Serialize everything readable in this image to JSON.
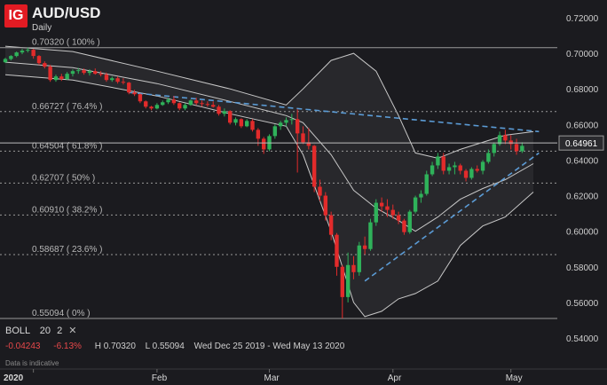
{
  "header": {
    "logo": "IG",
    "symbol": "AUD/USD",
    "timeframe": "Daily"
  },
  "indicator": {
    "name": "BOLL",
    "period": "20",
    "deviation": "2",
    "close_glyph": "✕"
  },
  "stats": {
    "change": "-0.04243",
    "change_pct": "-6.13%",
    "high": "H 0.70320",
    "low": "L 0.55094",
    "range": "Wed Dec 25 2019 - Wed May 13 2020"
  },
  "note": "Data is indicative",
  "colors": {
    "background": "#1b1b1f",
    "up_candle": "#2fb25a",
    "down_candle": "#e22b2b",
    "bands": "#c8c8c8",
    "trendline": "#5b9bd5",
    "logo": "#e21b23"
  },
  "chart_data": {
    "type": "candlestick",
    "instrument": "AUD/USD",
    "ylim": [
      0.54,
      0.72
    ],
    "y_ticks": [
      0.54,
      0.56,
      0.58,
      0.6,
      0.62,
      0.64,
      0.66,
      0.68,
      0.7,
      0.72
    ],
    "x_ticks": [
      "2020",
      "Feb",
      "Mar",
      "Apr",
      "May"
    ],
    "current_price": 0.64961,
    "fibonacci_levels": [
      {
        "label": "0.70320 ( 100% )",
        "value": 0.7032
      },
      {
        "label": "0.66727 ( 76.4% )",
        "value": 0.66727
      },
      {
        "label": "0.64504 ( 61.8% )",
        "value": 0.64504
      },
      {
        "label": "0.62707 ( 50% )",
        "value": 0.62707
      },
      {
        "label": "0.60910 ( 38.2% )",
        "value": 0.6091
      },
      {
        "label": "0.58687 ( 23.6% )",
        "value": 0.58687
      },
      {
        "label": "0.55094 ( 0% )",
        "value": 0.55094
      }
    ],
    "candles": [
      {
        "date": "2019-12-25",
        "o": 0.695,
        "h": 0.6975,
        "l": 0.6945,
        "c": 0.6968
      },
      {
        "date": "2019-12-26",
        "o": 0.6968,
        "h": 0.699,
        "l": 0.696,
        "c": 0.6985
      },
      {
        "date": "2019-12-27",
        "o": 0.6985,
        "h": 0.701,
        "l": 0.6978,
        "c": 0.7005
      },
      {
        "date": "2019-12-30",
        "o": 0.7005,
        "h": 0.7025,
        "l": 0.6995,
        "c": 0.7015
      },
      {
        "date": "2019-12-31",
        "o": 0.7015,
        "h": 0.7032,
        "l": 0.7005,
        "c": 0.702
      },
      {
        "date": "2020-01-02",
        "o": 0.702,
        "h": 0.7025,
        "l": 0.697,
        "c": 0.6985
      },
      {
        "date": "2020-01-03",
        "o": 0.6985,
        "h": 0.699,
        "l": 0.6935,
        "c": 0.6945
      },
      {
        "date": "2020-01-06",
        "o": 0.6945,
        "h": 0.6955,
        "l": 0.6915,
        "c": 0.6925
      },
      {
        "date": "2020-01-07",
        "o": 0.6925,
        "h": 0.6935,
        "l": 0.684,
        "c": 0.685
      },
      {
        "date": "2020-01-08",
        "o": 0.685,
        "h": 0.688,
        "l": 0.684,
        "c": 0.687
      },
      {
        "date": "2020-01-09",
        "o": 0.687,
        "h": 0.6885,
        "l": 0.6845,
        "c": 0.6855
      },
      {
        "date": "2020-01-10",
        "o": 0.6855,
        "h": 0.6895,
        "l": 0.685,
        "c": 0.6885
      },
      {
        "date": "2020-01-13",
        "o": 0.6885,
        "h": 0.691,
        "l": 0.687,
        "c": 0.69
      },
      {
        "date": "2020-01-14",
        "o": 0.69,
        "h": 0.6918,
        "l": 0.6885,
        "c": 0.6905
      },
      {
        "date": "2020-01-15",
        "o": 0.6905,
        "h": 0.6915,
        "l": 0.688,
        "c": 0.689
      },
      {
        "date": "2020-01-16",
        "o": 0.689,
        "h": 0.691,
        "l": 0.6875,
        "c": 0.69
      },
      {
        "date": "2020-01-17",
        "o": 0.69,
        "h": 0.6915,
        "l": 0.688,
        "c": 0.6885
      },
      {
        "date": "2020-01-20",
        "o": 0.6885,
        "h": 0.69,
        "l": 0.687,
        "c": 0.688
      },
      {
        "date": "2020-01-21",
        "o": 0.688,
        "h": 0.6892,
        "l": 0.684,
        "c": 0.685
      },
      {
        "date": "2020-01-22",
        "o": 0.685,
        "h": 0.687,
        "l": 0.684,
        "c": 0.686
      },
      {
        "date": "2020-01-23",
        "o": 0.686,
        "h": 0.687,
        "l": 0.683,
        "c": 0.684
      },
      {
        "date": "2020-01-24",
        "o": 0.684,
        "h": 0.686,
        "l": 0.6825,
        "c": 0.6835
      },
      {
        "date": "2020-01-27",
        "o": 0.6835,
        "h": 0.684,
        "l": 0.677,
        "c": 0.678
      },
      {
        "date": "2020-01-28",
        "o": 0.678,
        "h": 0.6795,
        "l": 0.676,
        "c": 0.677
      },
      {
        "date": "2020-01-29",
        "o": 0.677,
        "h": 0.6775,
        "l": 0.672,
        "c": 0.673
      },
      {
        "date": "2020-01-30",
        "o": 0.673,
        "h": 0.6735,
        "l": 0.669,
        "c": 0.67
      },
      {
        "date": "2020-01-31",
        "o": 0.67,
        "h": 0.6705,
        "l": 0.668,
        "c": 0.669
      },
      {
        "date": "2020-02-03",
        "o": 0.669,
        "h": 0.672,
        "l": 0.6685,
        "c": 0.671
      },
      {
        "date": "2020-02-04",
        "o": 0.671,
        "h": 0.6735,
        "l": 0.6705,
        "c": 0.6725
      },
      {
        "date": "2020-02-05",
        "o": 0.6725,
        "h": 0.675,
        "l": 0.6715,
        "c": 0.674
      },
      {
        "date": "2020-02-06",
        "o": 0.674,
        "h": 0.676,
        "l": 0.671,
        "c": 0.672
      },
      {
        "date": "2020-02-07",
        "o": 0.672,
        "h": 0.6725,
        "l": 0.668,
        "c": 0.669
      },
      {
        "date": "2020-02-10",
        "o": 0.669,
        "h": 0.672,
        "l": 0.668,
        "c": 0.671
      },
      {
        "date": "2020-02-11",
        "o": 0.671,
        "h": 0.674,
        "l": 0.6705,
        "c": 0.6735
      },
      {
        "date": "2020-02-12",
        "o": 0.6735,
        "h": 0.675,
        "l": 0.671,
        "c": 0.672
      },
      {
        "date": "2020-02-13",
        "o": 0.672,
        "h": 0.6735,
        "l": 0.67,
        "c": 0.6715
      },
      {
        "date": "2020-02-14",
        "o": 0.6715,
        "h": 0.673,
        "l": 0.67,
        "c": 0.671
      },
      {
        "date": "2020-02-17",
        "o": 0.671,
        "h": 0.673,
        "l": 0.6695,
        "c": 0.67
      },
      {
        "date": "2020-02-18",
        "o": 0.67,
        "h": 0.671,
        "l": 0.665,
        "c": 0.666
      },
      {
        "date": "2020-02-19",
        "o": 0.666,
        "h": 0.669,
        "l": 0.6645,
        "c": 0.6675
      },
      {
        "date": "2020-02-20",
        "o": 0.6675,
        "h": 0.668,
        "l": 0.66,
        "c": 0.661
      },
      {
        "date": "2020-02-21",
        "o": 0.661,
        "h": 0.664,
        "l": 0.6595,
        "c": 0.663
      },
      {
        "date": "2020-02-24",
        "o": 0.663,
        "h": 0.6635,
        "l": 0.658,
        "c": 0.659
      },
      {
        "date": "2020-02-25",
        "o": 0.659,
        "h": 0.663,
        "l": 0.6585,
        "c": 0.662
      },
      {
        "date": "2020-02-26",
        "o": 0.662,
        "h": 0.663,
        "l": 0.656,
        "c": 0.657
      },
      {
        "date": "2020-02-27",
        "o": 0.657,
        "h": 0.658,
        "l": 0.648,
        "c": 0.652
      },
      {
        "date": "2020-02-28",
        "o": 0.652,
        "h": 0.653,
        "l": 0.6435,
        "c": 0.646
      },
      {
        "date": "2020-03-02",
        "o": 0.646,
        "h": 0.6545,
        "l": 0.645,
        "c": 0.6535
      },
      {
        "date": "2020-03-03",
        "o": 0.6535,
        "h": 0.66,
        "l": 0.652,
        "c": 0.659
      },
      {
        "date": "2020-03-04",
        "o": 0.659,
        "h": 0.662,
        "l": 0.657,
        "c": 0.661
      },
      {
        "date": "2020-03-05",
        "o": 0.661,
        "h": 0.664,
        "l": 0.659,
        "c": 0.6625
      },
      {
        "date": "2020-03-06",
        "o": 0.6625,
        "h": 0.666,
        "l": 0.66,
        "c": 0.663
      },
      {
        "date": "2020-03-09",
        "o": 0.663,
        "h": 0.6685,
        "l": 0.633,
        "c": 0.655
      },
      {
        "date": "2020-03-10",
        "o": 0.655,
        "h": 0.659,
        "l": 0.649,
        "c": 0.65
      },
      {
        "date": "2020-03-11",
        "o": 0.65,
        "h": 0.658,
        "l": 0.646,
        "c": 0.648
      },
      {
        "date": "2020-03-12",
        "o": 0.648,
        "h": 0.6485,
        "l": 0.622,
        "c": 0.625
      },
      {
        "date": "2020-03-13",
        "o": 0.625,
        "h": 0.629,
        "l": 0.617,
        "c": 0.62
      },
      {
        "date": "2020-03-16",
        "o": 0.62,
        "h": 0.622,
        "l": 0.606,
        "c": 0.609
      },
      {
        "date": "2020-03-17",
        "o": 0.609,
        "h": 0.611,
        "l": 0.595,
        "c": 0.598
      },
      {
        "date": "2020-03-18",
        "o": 0.598,
        "h": 0.599,
        "l": 0.575,
        "c": 0.58
      },
      {
        "date": "2020-03-19",
        "o": 0.58,
        "h": 0.581,
        "l": 0.551,
        "c": 0.563
      },
      {
        "date": "2020-03-20",
        "o": 0.563,
        "h": 0.588,
        "l": 0.56,
        "c": 0.581
      },
      {
        "date": "2020-03-23",
        "o": 0.581,
        "h": 0.586,
        "l": 0.573,
        "c": 0.577
      },
      {
        "date": "2020-03-24",
        "o": 0.577,
        "h": 0.594,
        "l": 0.575,
        "c": 0.592
      },
      {
        "date": "2020-03-25",
        "o": 0.592,
        "h": 0.597,
        "l": 0.587,
        "c": 0.59
      },
      {
        "date": "2020-03-26",
        "o": 0.59,
        "h": 0.607,
        "l": 0.589,
        "c": 0.605
      },
      {
        "date": "2020-03-27",
        "o": 0.605,
        "h": 0.618,
        "l": 0.603,
        "c": 0.616
      },
      {
        "date": "2020-03-30",
        "o": 0.616,
        "h": 0.619,
        "l": 0.611,
        "c": 0.614
      },
      {
        "date": "2020-03-31",
        "o": 0.614,
        "h": 0.618,
        "l": 0.608,
        "c": 0.612
      },
      {
        "date": "2020-04-01",
        "o": 0.612,
        "h": 0.615,
        "l": 0.607,
        "c": 0.609
      },
      {
        "date": "2020-04-02",
        "o": 0.609,
        "h": 0.611,
        "l": 0.604,
        "c": 0.606
      },
      {
        "date": "2020-04-03",
        "o": 0.606,
        "h": 0.607,
        "l": 0.598,
        "c": 0.5995
      },
      {
        "date": "2020-04-06",
        "o": 0.5995,
        "h": 0.612,
        "l": 0.5985,
        "c": 0.611
      },
      {
        "date": "2020-04-07",
        "o": 0.611,
        "h": 0.62,
        "l": 0.61,
        "c": 0.619
      },
      {
        "date": "2020-04-08",
        "o": 0.619,
        "h": 0.623,
        "l": 0.616,
        "c": 0.621
      },
      {
        "date": "2020-04-09",
        "o": 0.621,
        "h": 0.634,
        "l": 0.62,
        "c": 0.632
      },
      {
        "date": "2020-04-13",
        "o": 0.632,
        "h": 0.639,
        "l": 0.631,
        "c": 0.637
      },
      {
        "date": "2020-04-14",
        "o": 0.637,
        "h": 0.644,
        "l": 0.635,
        "c": 0.642
      },
      {
        "date": "2020-04-15",
        "o": 0.642,
        "h": 0.644,
        "l": 0.632,
        "c": 0.634
      },
      {
        "date": "2020-04-16",
        "o": 0.634,
        "h": 0.638,
        "l": 0.632,
        "c": 0.636
      },
      {
        "date": "2020-04-17",
        "o": 0.636,
        "h": 0.639,
        "l": 0.632,
        "c": 0.637
      },
      {
        "date": "2020-04-20",
        "o": 0.637,
        "h": 0.638,
        "l": 0.632,
        "c": 0.634
      },
      {
        "date": "2020-04-21",
        "o": 0.634,
        "h": 0.635,
        "l": 0.628,
        "c": 0.63
      },
      {
        "date": "2020-04-22",
        "o": 0.63,
        "h": 0.636,
        "l": 0.629,
        "c": 0.635
      },
      {
        "date": "2020-04-23",
        "o": 0.635,
        "h": 0.637,
        "l": 0.633,
        "c": 0.634
      },
      {
        "date": "2020-04-24",
        "o": 0.634,
        "h": 0.64,
        "l": 0.632,
        "c": 0.639
      },
      {
        "date": "2020-04-27",
        "o": 0.639,
        "h": 0.646,
        "l": 0.638,
        "c": 0.644
      },
      {
        "date": "2020-04-28",
        "o": 0.644,
        "h": 0.65,
        "l": 0.642,
        "c": 0.649
      },
      {
        "date": "2020-04-29",
        "o": 0.649,
        "h": 0.656,
        "l": 0.648,
        "c": 0.654
      },
      {
        "date": "2020-04-30",
        "o": 0.654,
        "h": 0.657,
        "l": 0.649,
        "c": 0.651
      },
      {
        "date": "2020-05-01",
        "o": 0.651,
        "h": 0.654,
        "l": 0.646,
        "c": 0.649
      },
      {
        "date": "2020-05-04",
        "o": 0.649,
        "h": 0.652,
        "l": 0.643,
        "c": 0.645
      },
      {
        "date": "2020-05-05",
        "o": 0.645,
        "h": 0.65,
        "l": 0.644,
        "c": 0.648
      }
    ],
    "bollinger_bands": {
      "upper": [
        [
          0,
          0.704
        ],
        [
          12,
          0.701
        ],
        [
          27,
          0.69
        ],
        [
          40,
          0.68
        ],
        [
          50,
          0.671
        ],
        [
          53,
          0.68
        ],
        [
          58,
          0.696
        ],
        [
          62,
          0.7
        ],
        [
          66,
          0.69
        ],
        [
          70,
          0.665
        ],
        [
          73,
          0.644
        ],
        [
          77,
          0.641
        ],
        [
          81,
          0.646
        ],
        [
          85,
          0.65
        ],
        [
          89,
          0.654
        ],
        [
          94,
          0.656
        ]
      ],
      "middle": [
        [
          0,
          0.695
        ],
        [
          12,
          0.692
        ],
        [
          27,
          0.683
        ],
        [
          40,
          0.673
        ],
        [
          50,
          0.665
        ],
        [
          53,
          0.661
        ],
        [
          58,
          0.643
        ],
        [
          62,
          0.623
        ],
        [
          66,
          0.613
        ],
        [
          70,
          0.606
        ],
        [
          73,
          0.6
        ],
        [
          77,
          0.608
        ],
        [
          81,
          0.618
        ],
        [
          85,
          0.624
        ],
        [
          89,
          0.629
        ],
        [
          94,
          0.638
        ]
      ],
      "lower": [
        [
          0,
          0.688
        ],
        [
          12,
          0.685
        ],
        [
          27,
          0.676
        ],
        [
          40,
          0.666
        ],
        [
          50,
          0.659
        ],
        [
          53,
          0.643
        ],
        [
          58,
          0.6
        ],
        [
          62,
          0.56
        ],
        [
          64,
          0.552
        ],
        [
          67,
          0.555
        ],
        [
          70,
          0.562
        ],
        [
          73,
          0.565
        ],
        [
          77,
          0.572
        ],
        [
          81,
          0.592
        ],
        [
          85,
          0.603
        ],
        [
          89,
          0.608
        ],
        [
          94,
          0.622
        ]
      ]
    },
    "trendlines": [
      {
        "name": "resistance",
        "from": [
          22,
          0.678
        ],
        "to": [
          95,
          0.656
        ]
      },
      {
        "name": "support",
        "from": [
          64,
          0.572
        ],
        "to": [
          95,
          0.644
        ]
      }
    ]
  }
}
